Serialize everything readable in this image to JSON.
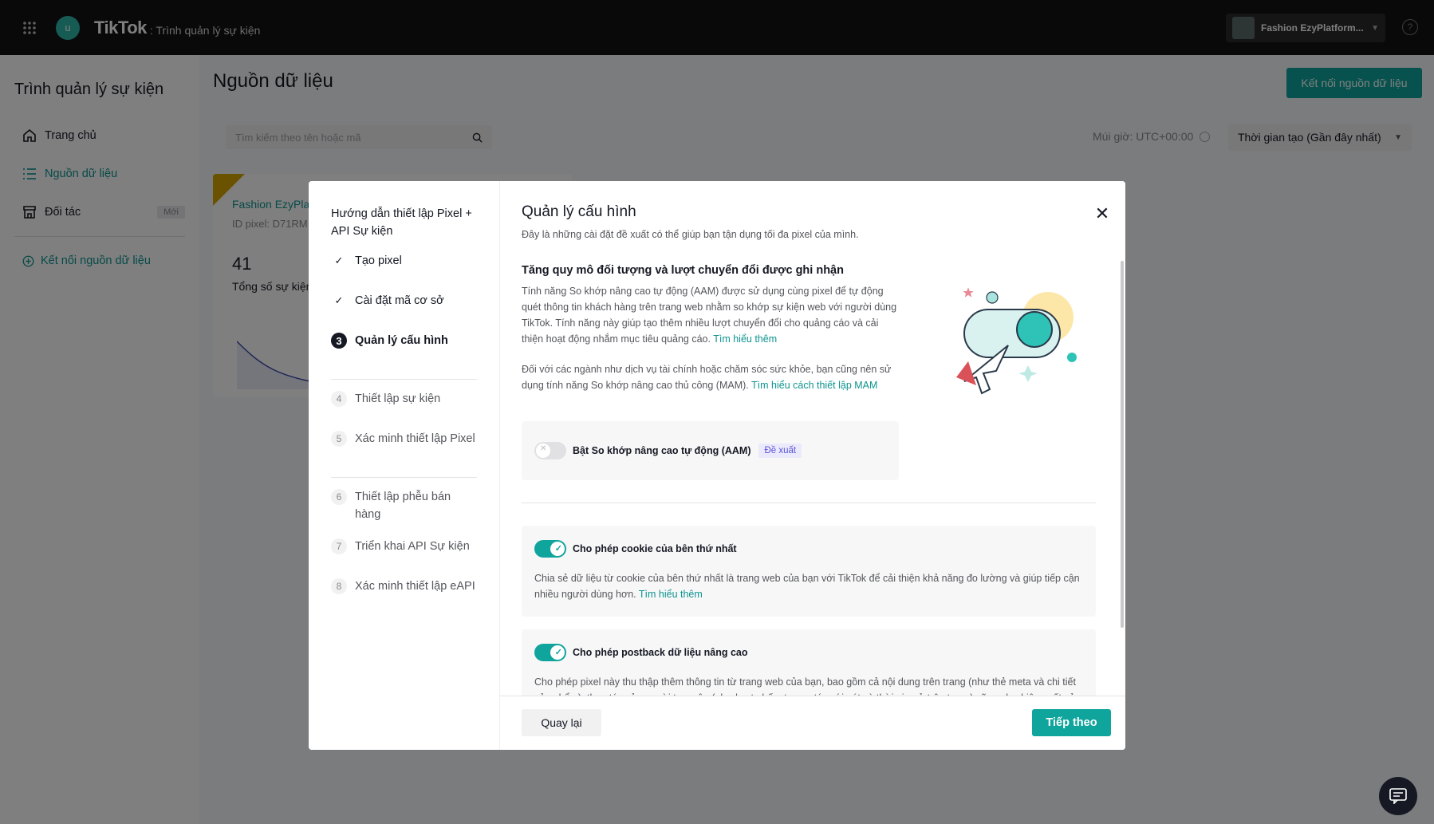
{
  "topbar": {
    "avatar_initial": "u",
    "logo": "TikTok",
    "logo_sub": ": Trình quản lý sự kiện",
    "account_name": "Fashion EzyPlatform...",
    "help": "?"
  },
  "sidebar": {
    "title": "Trình quản lý sự kiện",
    "items": [
      {
        "label": "Trang chủ"
      },
      {
        "label": "Nguồn dữ liệu"
      },
      {
        "label": "Đối tác",
        "badge": "Mới"
      }
    ],
    "connect_link": "Kết nối nguồn dữ liệu"
  },
  "main": {
    "title": "Nguồn dữ liệu",
    "connect_button": "Kết nối nguồn dữ liệu",
    "search_placeholder": "Tìm kiếm theo tên hoặc mã",
    "timezone": "Múi giờ: UTC+00:00",
    "sort": "Thời gian tạo (Gần đây nhất)",
    "card": {
      "name": "Fashion EzyPla",
      "pixel_id": "ID pixel: D71RM",
      "count": "41",
      "count_label": "Tổng số sự kiện"
    }
  },
  "modal": {
    "steps_title": "Hướng dẫn thiết lập Pixel + API Sự kiện",
    "steps": [
      {
        "mark": "✓",
        "label": "Tạo pixel"
      },
      {
        "mark": "✓",
        "label": "Cài đặt mã cơ sở"
      },
      {
        "mark": "3",
        "label": "Quản lý cấu hình"
      },
      {
        "mark": "4",
        "label": "Thiết lập sự kiện"
      },
      {
        "mark": "5",
        "label": "Xác minh thiết lập Pixel"
      },
      {
        "mark": "6",
        "label": "Thiết lập phễu bán hàng"
      },
      {
        "mark": "7",
        "label": "Triển khai API Sự kiện"
      },
      {
        "mark": "8",
        "label": "Xác minh thiết lập eAPI"
      }
    ],
    "title": "Quản lý cấu hình",
    "subtitle": "Đây là những cài đặt đề xuất có thể giúp bạn tận dụng tối đa pixel của mình.",
    "section_title": "Tăng quy mô đối tượng và lượt chuyển đổi được ghi nhận",
    "section_p1": "Tính năng So khớp nâng cao tự động (AAM) được sử dụng cùng pixel để tự động quét thông tin khách hàng trên trang web nhằm so khớp sự kiện web với người dùng TikTok. Tính năng này giúp tạo thêm nhiều lượt chuyển đổi cho quảng cáo và cải thiện hoạt động nhắm mục tiêu quảng cáo.",
    "section_p1_link": "Tìm hiểu thêm",
    "section_p2": "Đối với các ngành như dịch vụ tài chính hoặc chăm sóc sức khỏe, bạn cũng nên sử dụng tính năng So khớp nâng cao thủ công (MAM).",
    "section_p2_link": "Tìm hiểu cách thiết lập MAM",
    "aam_label": "Bật So khớp nâng cao tự động (AAM)",
    "aam_badge": "Đề xuất",
    "cookie_label": "Cho phép cookie của bên thứ nhất",
    "cookie_desc": "Chia sẻ dữ liệu từ cookie của bên thứ nhất là trang web của bạn với TikTok để cải thiện khả năng đo lường và giúp tiếp cận nhiều người dùng hơn.",
    "cookie_link": "Tìm hiểu thêm",
    "postback_label": "Cho phép postback dữ liệu nâng cao",
    "postback_desc": "Cho phép pixel này thu thập thêm thông tin từ trang web của bạn, bao gồm cả nội dung trên trang (như thẻ meta và chi tiết sản phẩm), thao tác của người truy cập (như lượt nhấp, tương tác với nút và thời gian ở trên trang) cũng như hiệu suất của",
    "back_button": "Quay lại",
    "next_button": "Tiếp theo",
    "close": "✕"
  },
  "colors": {
    "accent": "#0fa59c",
    "link": "#0d9490",
    "topbar": "#121212",
    "suggest_badge": "#5b55d6"
  }
}
